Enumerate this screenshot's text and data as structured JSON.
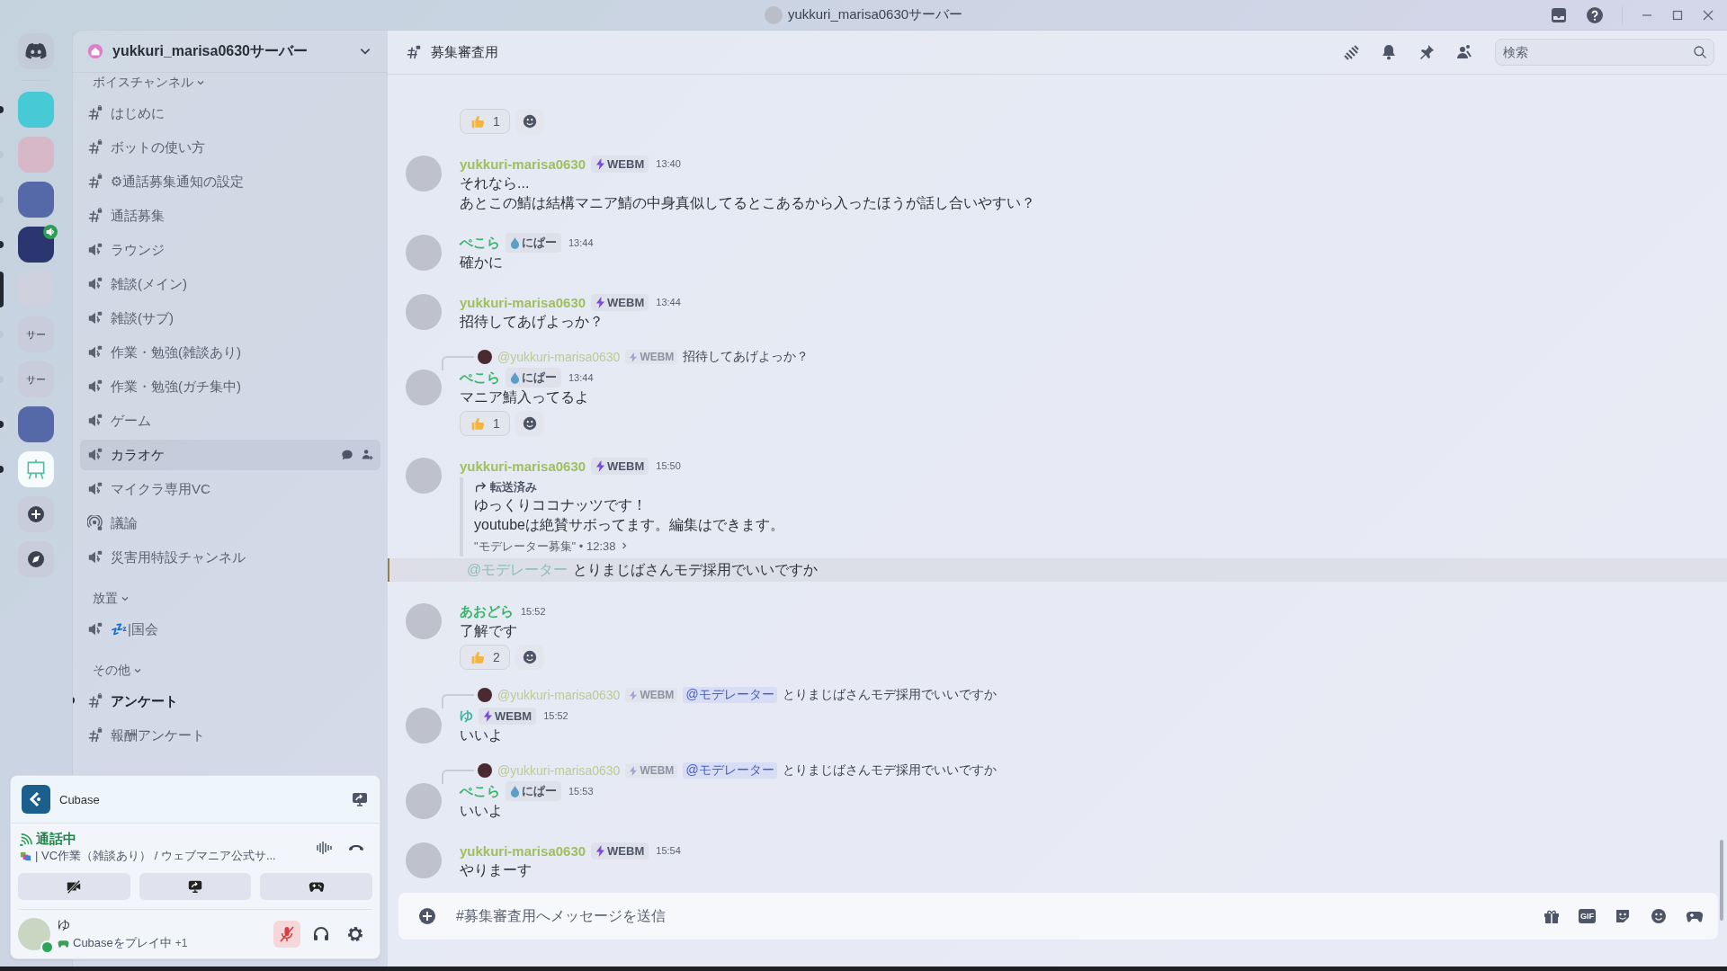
{
  "window": {
    "title": "yukkuri_marisa0630サーバー"
  },
  "servers": [
    {
      "kind": "image",
      "unread": true,
      "selected": false,
      "voice": false
    },
    {
      "kind": "image",
      "unread": false,
      "selected": false,
      "voice": false
    },
    {
      "kind": "image",
      "unread": false,
      "selected": false,
      "voice": false
    },
    {
      "kind": "image",
      "unread": true,
      "selected": false,
      "voice": true
    },
    {
      "kind": "image",
      "unread": false,
      "selected": true,
      "voice": false
    },
    {
      "kind": "text",
      "label": "サー",
      "unread": false,
      "selected": false,
      "voice": false
    },
    {
      "kind": "text",
      "label": "サー",
      "unread": false,
      "selected": false,
      "voice": false
    },
    {
      "kind": "image",
      "unread": true,
      "selected": false,
      "voice": false
    },
    {
      "kind": "board",
      "unread": true,
      "selected": false,
      "voice": false
    }
  ],
  "sidebar": {
    "server_name": "yukkuri_marisa0630サーバー",
    "categories": [
      {
        "name": "ボイスチャンネル",
        "channels": [
          {
            "kind": "text",
            "name": "はじめに",
            "selected": false,
            "unread": false
          },
          {
            "kind": "text",
            "name": "ボットの使い方",
            "selected": false,
            "unread": false
          },
          {
            "kind": "text",
            "name": "⚙通話募集通知の設定",
            "selected": false,
            "unread": false
          },
          {
            "kind": "text",
            "name": "通話募集",
            "selected": false,
            "unread": false
          },
          {
            "kind": "voice",
            "name": "ラウンジ",
            "selected": false,
            "unread": false
          },
          {
            "kind": "voice",
            "name": "雑談(メイン)",
            "selected": false,
            "unread": false
          },
          {
            "kind": "voice",
            "name": "雑談(サブ)",
            "selected": false,
            "unread": false
          },
          {
            "kind": "voice",
            "name": "作業・勉強(雑談あり)",
            "selected": false,
            "unread": false
          },
          {
            "kind": "voice",
            "name": "作業・勉強(ガチ集中)",
            "selected": false,
            "unread": false
          },
          {
            "kind": "voice",
            "name": "ゲーム",
            "selected": false,
            "unread": false
          },
          {
            "kind": "voice",
            "name": "カラオケ",
            "selected": true,
            "unread": false
          },
          {
            "kind": "voice",
            "name": "マイクラ専用VC",
            "selected": false,
            "unread": false
          },
          {
            "kind": "stage",
            "name": "議論",
            "selected": false,
            "unread": false
          },
          {
            "kind": "voice",
            "name": "災害用特設チャンネル",
            "selected": false,
            "unread": false
          }
        ]
      },
      {
        "name": "放置",
        "channels": [
          {
            "kind": "voice",
            "name": "💤|国会",
            "selected": false,
            "unread": false
          }
        ]
      },
      {
        "name": "その他",
        "channels": [
          {
            "kind": "text",
            "name": "アンケート",
            "selected": false,
            "unread": true
          },
          {
            "kind": "text",
            "name": "報酬アンケート",
            "selected": false,
            "unread": false
          }
        ]
      }
    ]
  },
  "activity": {
    "app": "Cubase"
  },
  "voice": {
    "status": "通話中",
    "channel": "| VC作業（雑談あり） / ウェブマニア公式サ..."
  },
  "user": {
    "name": "ゆ",
    "activity": "Cubaseをプレイ中",
    "extra": "+1",
    "muted": true
  },
  "chat": {
    "channel": "募集審査用",
    "search": {
      "placeholder": "検索"
    },
    "messages": [
      {
        "kind": "reactions",
        "reactions": [
          {
            "count": "1"
          }
        ]
      },
      {
        "kind": "message",
        "author": "yukkuri-marisa0630",
        "color": "#9fbf5f",
        "tag": {
          "kind": "webm",
          "label": "WEBM"
        },
        "time": "13:40",
        "lines": [
          "それなら...",
          "あとこの鯖は結構マニア鯖の中身真似してるとこあるから入ったほうが話し合いやすい？"
        ]
      },
      {
        "kind": "message",
        "author": "ぺこら",
        "color": "#3db26a",
        "tag": {
          "kind": "nipa",
          "label": "にぱー"
        },
        "time": "13:44",
        "lines": [
          "確かに"
        ]
      },
      {
        "kind": "message",
        "author": "yukkuri-marisa0630",
        "color": "#9fbf5f",
        "tag": {
          "kind": "webm",
          "label": "WEBM"
        },
        "time": "13:44",
        "lines": [
          "招待してあげよっか？"
        ]
      },
      {
        "kind": "message",
        "reply": {
          "author": "@yukkuri-marisa0630",
          "tag": "WEBM",
          "text": "招待してあげよっか？"
        },
        "author": "ぺこら",
        "color": "#3db26a",
        "tag": {
          "kind": "nipa",
          "label": "にぱー"
        },
        "time": "13:44",
        "lines": [
          "マニア鯖入ってるよ"
        ],
        "reactions": [
          {
            "count": "1"
          }
        ]
      },
      {
        "kind": "message",
        "author": "yukkuri-marisa0630",
        "color": "#9fbf5f",
        "tag": {
          "kind": "webm",
          "label": "WEBM"
        },
        "time": "15:50",
        "forward": {
          "label": "転送済み",
          "lines": [
            "ゆっくりココナッツです！",
            "youtubeは絶賛サボってます。編集はできます。"
          ],
          "source": "\"モデレーター募集\" • 12:38"
        }
      },
      {
        "kind": "mention",
        "highlighted": true,
        "mention": "@モデレーター",
        "text": "とりまじばさんモデ採用でいいですか"
      },
      {
        "kind": "message",
        "author": "あおどら",
        "color": "#3db26a",
        "time": "15:52",
        "lines": [
          "了解です"
        ],
        "reactions": [
          {
            "count": "2"
          }
        ]
      },
      {
        "kind": "message",
        "reply": {
          "author": "@yukkuri-marisa0630",
          "tag": "WEBM",
          "mention": "@モデレーター",
          "text": "とりまじばさんモデ採用でいいですか"
        },
        "author": "ゆ",
        "color": "#43b3a0",
        "tag": {
          "kind": "webm",
          "label": "WEBM"
        },
        "time": "15:52",
        "lines": [
          "いいよ"
        ]
      },
      {
        "kind": "message",
        "reply": {
          "author": "@yukkuri-marisa0630",
          "tag": "WEBM",
          "mention": "@モデレーター",
          "text": "とりまじばさんモデ採用でいいですか"
        },
        "author": "ぺこら",
        "color": "#3db26a",
        "tag": {
          "kind": "nipa",
          "label": "にぱー"
        },
        "time": "15:53",
        "lines": [
          "いいよ"
        ]
      },
      {
        "kind": "message",
        "author": "yukkuri-marisa0630",
        "color": "#9fbf5f",
        "tag": {
          "kind": "webm",
          "label": "WEBM"
        },
        "time": "15:54",
        "lines": [
          "やりまーす"
        ]
      }
    ],
    "composer": {
      "placeholder": "#募集審査用へメッセージを送信",
      "gif_label": "GIF"
    }
  }
}
